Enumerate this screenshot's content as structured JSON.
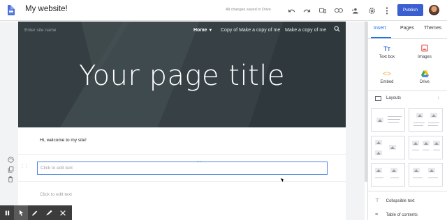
{
  "topbar": {
    "site_title": "My website!",
    "save_status": "All changes saved in Drive",
    "publish_label": "Publish",
    "icons": [
      "undo-icon",
      "redo-icon",
      "preview-icon",
      "link-icon",
      "share-icon",
      "settings-icon",
      "more-icon"
    ]
  },
  "site": {
    "nav_site_name": "Enter site name",
    "nav_items": [
      "Home",
      "Copy of Make a copy of me",
      "Make a copy of me"
    ],
    "hero_title": "Your page title",
    "welcome_text": "Hi, welcome to my site!",
    "edit_placeholder": "Click to edit text",
    "placeholder_second": "Click to edit text"
  },
  "panel": {
    "tabs": [
      "Insert",
      "Pages",
      "Themes"
    ],
    "insert_items": [
      {
        "label": "Text box",
        "icon": "text-box-icon"
      },
      {
        "label": "Images",
        "icon": "image-icon"
      },
      {
        "label": "Embed",
        "icon": "embed-icon"
      },
      {
        "label": "Drive",
        "icon": "drive-icon"
      }
    ],
    "layouts_label": "Layouts",
    "collapsible_label": "Collapsible text",
    "toc_label": "Table of contents"
  },
  "colors": {
    "accent": "#1a73e8",
    "publish": "#3b5fd1",
    "hero_bg": "#3a4448"
  }
}
